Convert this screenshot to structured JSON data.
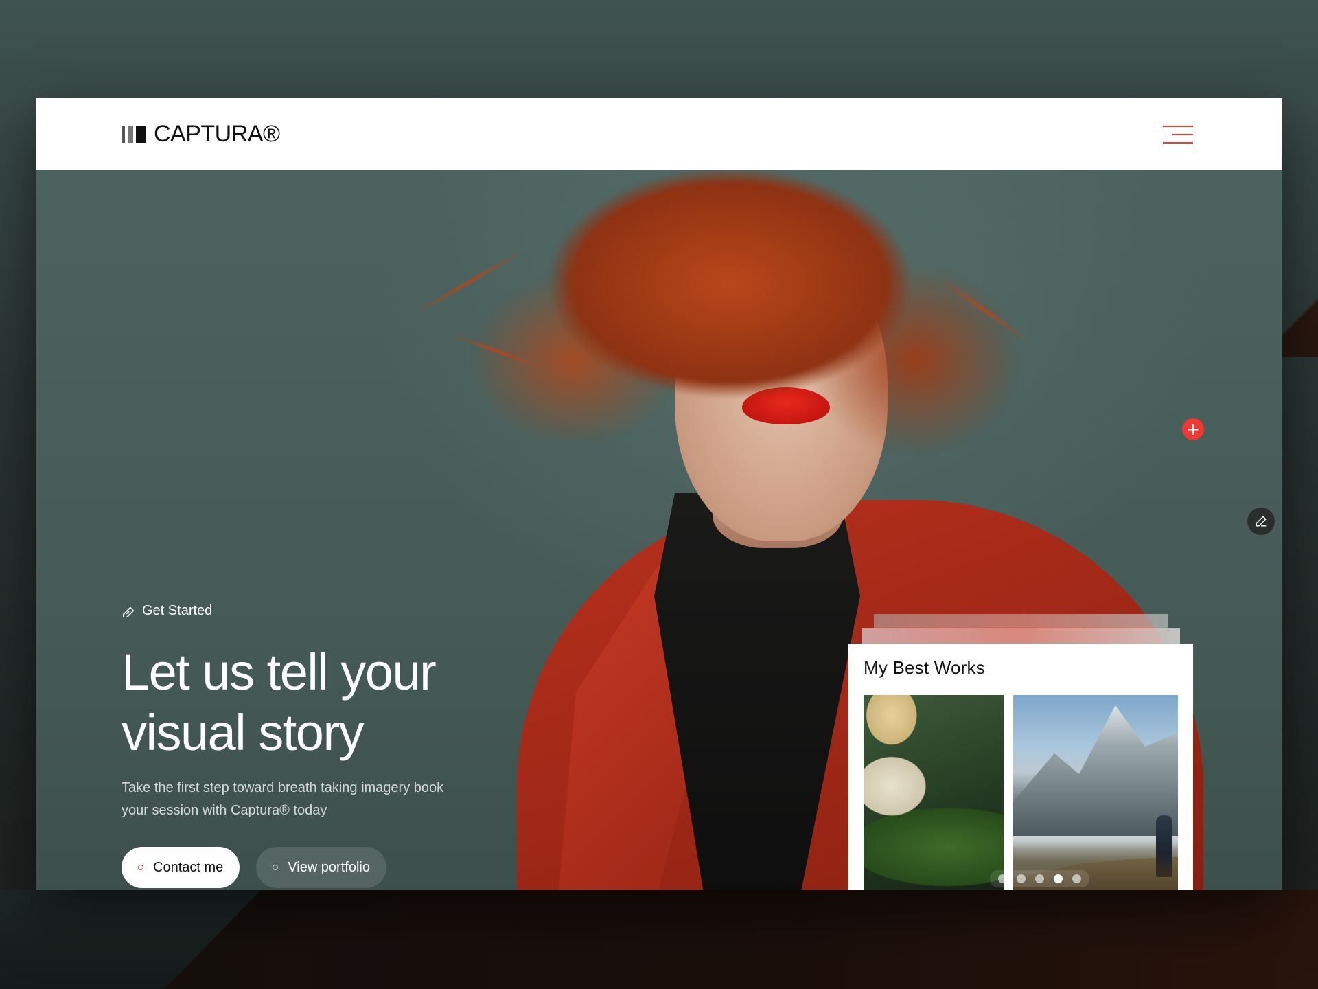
{
  "brand": {
    "name": "CAPTURA®"
  },
  "hero": {
    "eyebrow": "Get Started",
    "headline_line1": "Let us tell your",
    "headline_line2": "visual story",
    "subtitle": "Take the first step toward breath taking imagery book your session with Captura® today",
    "primary_cta": "Contact me",
    "secondary_cta": "View portfolio"
  },
  "works": {
    "title": "My Best Works",
    "carousel_dots": 5,
    "active_dot": 4
  },
  "icons": {
    "menu": "hamburger-menu-icon",
    "plus": "plus-icon",
    "edit": "pen-icon",
    "eyebrow": "pen-tool-icon"
  },
  "colors": {
    "accent": "#e84032",
    "plus_button": "#ee3a34",
    "hero_bg": "#4a605c",
    "coat": "#b7301e"
  }
}
